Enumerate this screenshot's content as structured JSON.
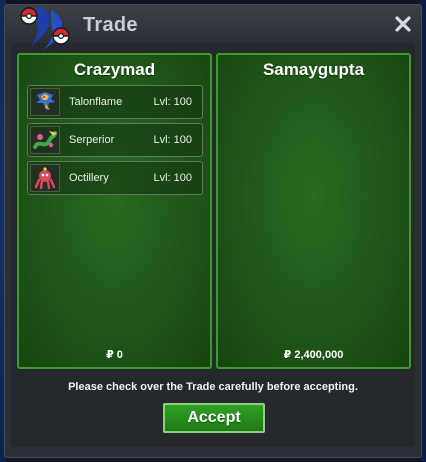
{
  "window": {
    "title": "Trade",
    "close_icon": "close-icon",
    "logo_icon": "pokeball-logo-icon"
  },
  "left_panel": {
    "player_name": "Crazymad",
    "pokemon": [
      {
        "name": "Talonflame",
        "level": "Lvl: 100",
        "sprite_icon": "talonflame-sprite-icon"
      },
      {
        "name": "Serperior",
        "level": "Lvl: 100",
        "sprite_icon": "serperior-sprite-icon"
      },
      {
        "name": "Octillery",
        "level": "Lvl: 100",
        "sprite_icon": "octillery-sprite-icon"
      }
    ],
    "money": "₽ 0"
  },
  "right_panel": {
    "player_name": "Samaygupta",
    "pokemon": [],
    "money": "₽ 2,400,000"
  },
  "footer": {
    "notice": "Please check over the Trade carefully before accepting.",
    "accept_label": "Accept"
  },
  "colors": {
    "panel_green": "#1f5618",
    "panel_border": "#3c9a2c",
    "accept_green": "#2fa024",
    "window_bg": "#2c2f35"
  }
}
